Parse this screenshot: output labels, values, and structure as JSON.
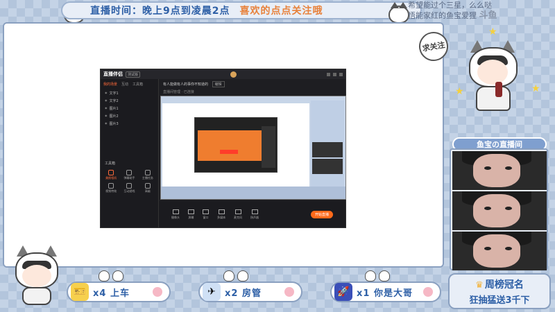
{
  "top_banner": {
    "schedule_label": "直播时间：晚上9点到凌晨2点",
    "follow_text": "喜欢的点点关注哦"
  },
  "top_right": {
    "line1": "希望能过个三星，么么哒",
    "line2": "悟能家红的鱼宝爱狸",
    "logo": "斗鱼"
  },
  "follow_bubble": "求关注",
  "room_title": "鱼宝の直播间",
  "app": {
    "brand": "直播伴侣",
    "version": "测试版",
    "tabs": [
      "我的场景",
      "互动",
      "工具箱"
    ],
    "scenes": [
      "文字1",
      "文字2",
      "图片1",
      "图片2",
      "图片3"
    ],
    "tools_title": "工具箱",
    "tools": [
      "美颜相机",
      "弹幕助手",
      "主播任务",
      "视频特效",
      "互动游戏",
      "高级"
    ],
    "room_line": "有人能做有人的事你不知道的",
    "room_btn": "编辑",
    "meta": "直播间管理 · 已连接",
    "controls": [
      "摄像头",
      "屏幕",
      "窗口",
      "多媒体",
      "麦克风",
      "扬声器"
    ],
    "start_button": "开始直播"
  },
  "gifts": [
    {
      "text": "x4 上车",
      "icon": "ticket-icon"
    },
    {
      "text": "x2 房管",
      "icon": "plane-icon"
    },
    {
      "text": "x1 你是大哥",
      "icon": "rocket-icon"
    }
  ],
  "weekly": {
    "title": "周榜冠名",
    "subtitle": "狂抽猛送3千下"
  }
}
